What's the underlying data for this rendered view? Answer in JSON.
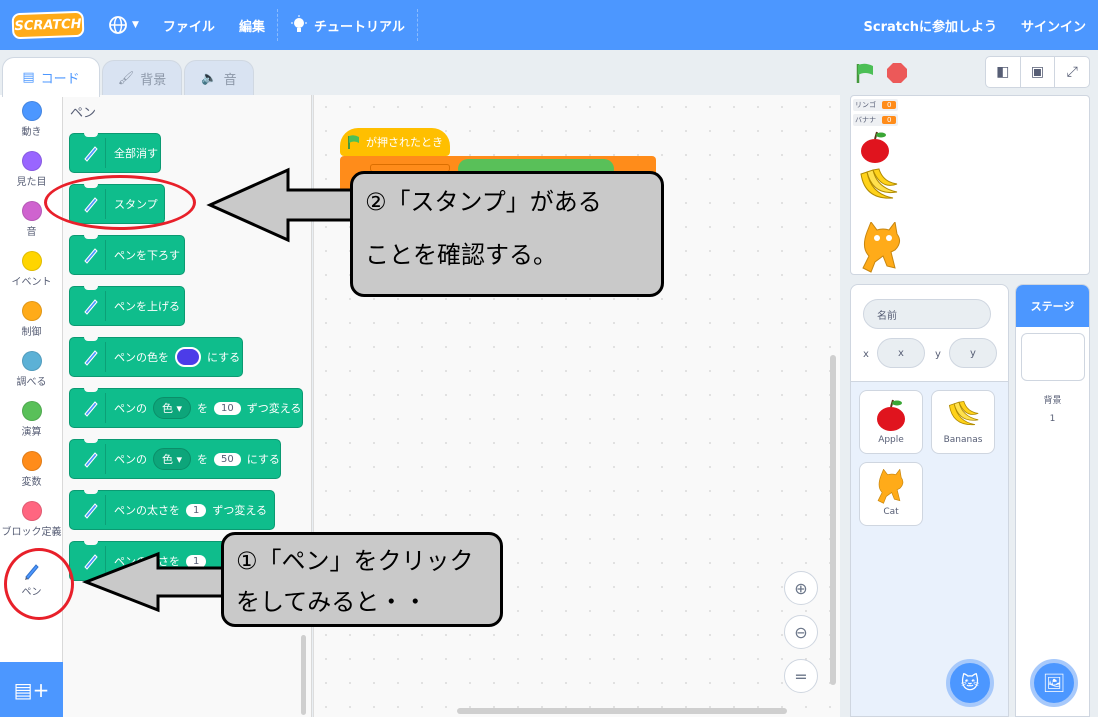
{
  "menubar": {
    "logo_text": "SCRATCH",
    "globe_icon": "globe-icon",
    "file": "ファイル",
    "edit": "編集",
    "tutorials": "チュートリアル",
    "join": "Scratchに参加しよう",
    "signin": "サインイン"
  },
  "tabs": {
    "code": "コード",
    "costumes": "背景",
    "sounds": "音"
  },
  "categories": [
    {
      "label": "動き",
      "color": "#4c97ff"
    },
    {
      "label": "見た目",
      "color": "#9966ff"
    },
    {
      "label": "音",
      "color": "#cf63cf"
    },
    {
      "label": "イベント",
      "color": "#ffd500"
    },
    {
      "label": "制御",
      "color": "#ffab19"
    },
    {
      "label": "調べる",
      "color": "#5cb1d6"
    },
    {
      "label": "演算",
      "color": "#59c059"
    },
    {
      "label": "変数",
      "color": "#ff8c1a"
    },
    {
      "label": "ブロック定義",
      "color": "#ff6680"
    },
    {
      "label": "ペン",
      "color": ""
    }
  ],
  "palette": {
    "title": "ペン",
    "blocks": {
      "clear": "全部消す",
      "stamp": "スタンプ",
      "pen_down": "ペンを下ろす",
      "pen_up": "ペンを上げる",
      "set_color_a": "ペンの色を",
      "set_color_b": "にする",
      "change_param_a": "ペンの",
      "change_param_dd": "色",
      "change_param_b": "を",
      "change_param_val": "10",
      "change_param_c": "ずつ変える",
      "set_param_a": "ペンの",
      "set_param_dd": "色",
      "set_param_b": "を",
      "set_param_val": "50",
      "set_param_c": "にする",
      "change_size_a": "ペンの太さを",
      "change_size_val": "1",
      "change_size_b": "ずつ変える",
      "set_size_a": "ペンの太さを",
      "set_size_val": "1"
    }
  },
  "code": {
    "hat_label": "が押されたとき"
  },
  "stage": {
    "monitors": [
      {
        "label": "リンゴ",
        "value": "0"
      },
      {
        "label": "バナナ",
        "value": "0"
      }
    ]
  },
  "sprite_info": {
    "name_placeholder": "名前",
    "x_label": "x",
    "y_label": "y",
    "x_placeholder": "x",
    "y_placeholder": "y"
  },
  "sprites": [
    {
      "name": "Apple"
    },
    {
      "name": "Bananas"
    },
    {
      "name": "Cat"
    }
  ],
  "stage_selector": {
    "title": "ステージ",
    "backdrops_label": "背景",
    "backdrops_count": "1"
  },
  "annotations": {
    "callout_top_line1": "②「スタンプ」がある",
    "callout_top_line2": "ことを確認する。",
    "callout_bottom_line1": "①「ペン」をクリック",
    "callout_bottom_line2": "をしてみると・・"
  }
}
